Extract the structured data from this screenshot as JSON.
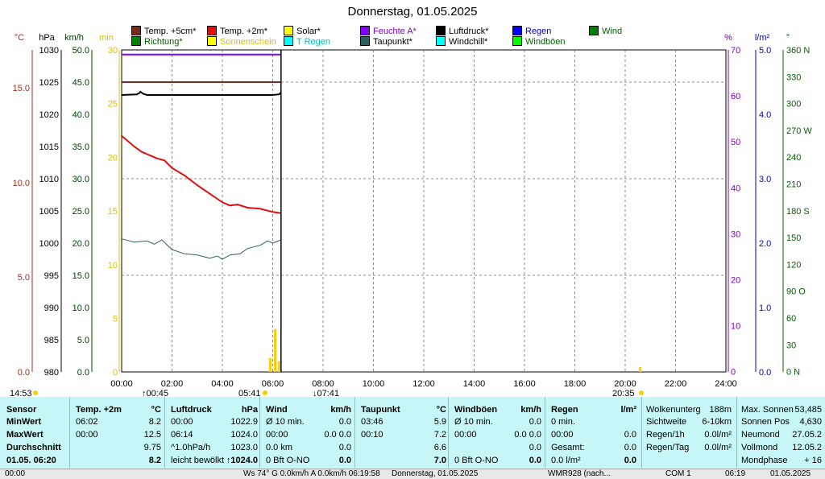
{
  "title": "Donnerstag, 01.05.2025",
  "legend": [
    {
      "label": "Temp. +5cm*",
      "color": "#7a2a20",
      "text_color": "#000000"
    },
    {
      "label": "Temp. +2m*",
      "color": "#e01010",
      "text_color": "#000000"
    },
    {
      "label": "Solar*",
      "color": "#ffff00",
      "text_color": "#000000"
    },
    {
      "label": "Feuchte A*",
      "color": "#8000ff",
      "text_color": "#8000c0"
    },
    {
      "label": "Luftdruck*",
      "color": "#000000",
      "text_color": "#000000"
    },
    {
      "label": "Regen",
      "color": "#0000ff",
      "text_color": "#0000c0"
    },
    {
      "label": "Wind",
      "color": "#008000",
      "text_color": "#006000"
    },
    {
      "label": "Richtung*",
      "color": "#008000",
      "text_color": "#006000"
    },
    {
      "label": "Sonnenschein",
      "color": "#ffff00",
      "text_color": "#e0c000"
    },
    {
      "label": "T Regen",
      "color": "#00ffff",
      "text_color": "#00c0c0"
    },
    {
      "label": "Taupunkt*",
      "color": "#2a6060",
      "text_color": "#000000"
    },
    {
      "label": "Windchill*",
      "color": "#00ffff",
      "text_color": "#000000"
    },
    {
      "label": "Windböen",
      "color": "#00ff00",
      "text_color": "#006000"
    }
  ],
  "axis_units": {
    "temp": "°C",
    "pressure": "hPa",
    "wind": "km/h",
    "minutes": "min",
    "humidity": "%",
    "rain": "l/m²",
    "direction": "°"
  },
  "axes": {
    "temp_ticks": [
      "15.0",
      "10.0",
      "5.0",
      "0.0"
    ],
    "pressure_ticks": [
      "1030",
      "1025",
      "1020",
      "1015",
      "1010",
      "1005",
      "1000",
      "995",
      "990",
      "985",
      "980"
    ],
    "wind_ticks": [
      "50.0",
      "45.0",
      "40.0",
      "35.0",
      "30.0",
      "25.0",
      "20.0",
      "15.0",
      "10.0",
      "5.0",
      "0.0"
    ],
    "minutes_ticks": [
      "30",
      "25",
      "20",
      "15",
      "10",
      "5",
      "0"
    ],
    "humidity_ticks": [
      "70",
      "60",
      "50",
      "40",
      "30",
      "20",
      "10",
      "0"
    ],
    "rain_ticks": [
      "5.0",
      "4.0",
      "3.0",
      "2.0",
      "1.0",
      "0.0"
    ],
    "direction_ticks": [
      "360 N",
      "330",
      "300",
      "270 W",
      "240",
      "210",
      "180 S",
      "150",
      "120",
      "90  O",
      "60",
      "30",
      "0    N"
    ],
    "time_ticks": [
      "00:00",
      "02:00",
      "04:00",
      "06:00",
      "08:00",
      "10:00",
      "12:00",
      "14:00",
      "16:00",
      "18:00",
      "20:00",
      "22:00",
      "24:00"
    ]
  },
  "time_markers": {
    "sunrise": "05:41",
    "sunset": "20:35",
    "moonrise": "00:45",
    "moonset": "07:41",
    "dawn": "14:53"
  },
  "chart_data": {
    "type": "line",
    "title": "Donnerstag, 01.05.2025",
    "x_unit": "hours",
    "xlim": [
      0,
      24
    ],
    "series": [
      {
        "name": "Temp. +2m*",
        "color": "#e01010",
        "axis": "minutes",
        "x": [
          0,
          0.5,
          0.8,
          1.1,
          1.4,
          1.7,
          2.0,
          2.5,
          3.0,
          3.5,
          4.0,
          4.3,
          4.6,
          5.0,
          5.5,
          6.0,
          6.33
        ],
        "values": [
          22.0,
          21.0,
          20.5,
          20.2,
          19.9,
          19.7,
          19.0,
          18.3,
          17.4,
          16.6,
          15.8,
          15.5,
          15.6,
          15.3,
          15.2,
          14.9,
          14.8
        ]
      },
      {
        "name": "Taupunkt*",
        "color": "#2a6060",
        "axis": "minutes",
        "x": [
          0,
          0.5,
          1.0,
          1.3,
          1.6,
          2.0,
          2.5,
          3.0,
          3.5,
          3.8,
          4.0,
          4.3,
          4.7,
          5.0,
          5.5,
          5.8,
          6.0,
          6.33
        ],
        "values": [
          12.4,
          12.1,
          12.2,
          11.9,
          12.3,
          11.4,
          11.0,
          10.9,
          10.6,
          10.8,
          10.5,
          10.9,
          11.0,
          11.5,
          11.8,
          12.2,
          12.0,
          12.3
        ]
      },
      {
        "name": "Luftdruck*",
        "color": "#000000",
        "axis": "pressure",
        "x": [
          0,
          0.6,
          0.7,
          0.75,
          0.85,
          1.0,
          2.0,
          3.0,
          4.0,
          5.0,
          6.0,
          6.25,
          6.33
        ],
        "values": [
          1023.0,
          1023.1,
          1023.3,
          1023.5,
          1023.2,
          1023.0,
          1023.0,
          1023.0,
          1023.0,
          1023.0,
          1023.0,
          1023.1,
          1023.4
        ]
      },
      {
        "name": "Temp. +5cm*",
        "color": "#7a2a20",
        "axis": "minutes",
        "x": [
          0,
          6.33
        ],
        "values": [
          27.0,
          27.0
        ]
      },
      {
        "name": "Feuchte A*",
        "color": "#8000ff",
        "axis": "humidity",
        "x": [
          0,
          6.33
        ],
        "values": [
          69,
          69
        ]
      },
      {
        "name": "Solar*",
        "color": "#ffcc00",
        "axis": "minutes",
        "bars": [
          {
            "x": 5.9,
            "value": 1.3
          },
          {
            "x": 6.1,
            "value": 4.0
          },
          {
            "x": 6.25,
            "value": 1.0
          }
        ]
      }
    ],
    "cursor_x": 6.33
  },
  "panel": {
    "sensor": {
      "header": "Sensor",
      "min": "MinWert",
      "max": "MaxWert",
      "avg": "Durchschnitt",
      "now": "01.05. 06:20"
    },
    "temp": {
      "header": "Temp. +2m",
      "unit": "°C",
      "rows": [
        [
          "06:02",
          "8.2"
        ],
        [
          "00:00",
          "12.5"
        ],
        [
          "",
          "9.75"
        ],
        [
          "",
          "8.2"
        ]
      ]
    },
    "pressure": {
      "header": "Luftdruck",
      "unit": "hPa",
      "rows": [
        [
          "00:00",
          "1022.9"
        ],
        [
          "06:14",
          "1024.0"
        ],
        [
          "^1.0hPa/h",
          "1023.0"
        ],
        [
          "leicht bewölkt",
          "↑1024.0"
        ]
      ]
    },
    "wind": {
      "header": "Wind",
      "unit": "km/h",
      "rows": [
        [
          "Ø 10 min.",
          "0.0"
        ],
        [
          "00:00",
          "0.0  0.0"
        ],
        [
          "0.0 km",
          "0.0"
        ],
        [
          "0 Bft O-NO",
          "0.0"
        ]
      ]
    },
    "dew": {
      "header": "Taupunkt",
      "unit": "°C",
      "rows": [
        [
          "03:46",
          "5.9"
        ],
        [
          "00:10",
          "7.2"
        ],
        [
          "",
          "6.6"
        ],
        [
          "",
          "7.0"
        ]
      ]
    },
    "gust": {
      "header": "Windböen",
      "unit": "km/h",
      "rows": [
        [
          "Ø 10 min.",
          "0.0"
        ],
        [
          "00:00",
          "0.0  0.0"
        ],
        [
          "",
          "0.0"
        ],
        [
          "0 Bft O-NO",
          "0.0"
        ]
      ]
    },
    "rain": {
      "header": "Regen",
      "unit": "l/m²",
      "rows": [
        [
          "0 min.",
          ""
        ],
        [
          "00:00",
          "0.0"
        ],
        [
          "Gesamt:",
          "0.0"
        ],
        [
          "0.0 l/m²",
          "0.0"
        ]
      ]
    },
    "cloud": {
      "rows": [
        [
          "Wolkenunterg",
          "188m"
        ],
        [
          "Sichtweite",
          "6-10km"
        ],
        [
          "Regen/1h",
          "0.0l/m²"
        ],
        [
          "Regen/Tag",
          "0.0l/m²"
        ]
      ]
    },
    "sun": {
      "rows": [
        [
          "Max. Sonnen",
          "53,485"
        ],
        [
          "Sonnen Pos",
          "4,630"
        ],
        [
          "Neumond",
          "27.05.2"
        ],
        [
          "Vollmond",
          "12.05.2"
        ],
        [
          "Mondphase",
          "+ 16"
        ]
      ]
    }
  },
  "statusbar": [
    "00:00",
    "Ws 74° G  0.0km/h  A  0.0km/h  06:19:58",
    "Donnerstag, 01.05.2025",
    "WMR928  (nach...",
    "COM 1",
    "06:19",
    "01.05.2025"
  ]
}
